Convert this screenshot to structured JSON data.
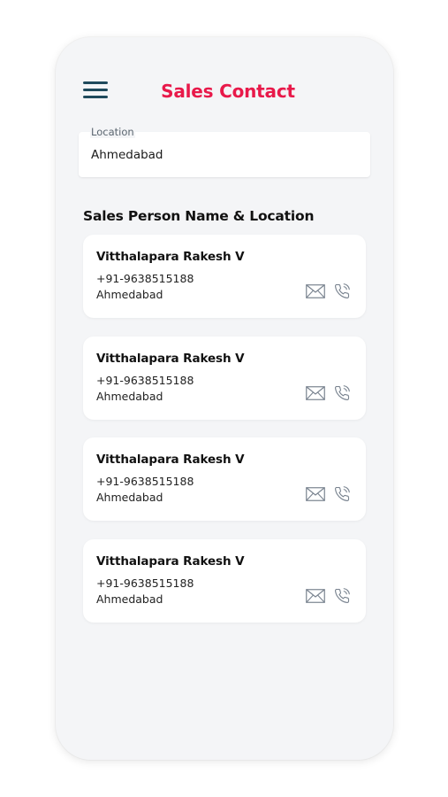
{
  "header": {
    "title": "Sales Contact"
  },
  "location": {
    "label": "Location",
    "value": "Ahmedabad"
  },
  "section": {
    "title": "Sales Person Name & Location"
  },
  "contacts": [
    {
      "name": "Vitthalapara Rakesh V",
      "phone": "+91-9638515188",
      "city": "Ahmedabad"
    },
    {
      "name": "Vitthalapara Rakesh V",
      "phone": "+91-9638515188",
      "city": "Ahmedabad"
    },
    {
      "name": "Vitthalapara Rakesh V",
      "phone": "+91-9638515188",
      "city": "Ahmedabad"
    },
    {
      "name": "Vitthalapara Rakesh V",
      "phone": "+91-9638515188",
      "city": "Ahmedabad"
    }
  ],
  "icons": {
    "menu": "hamburger-menu-icon",
    "mail": "mail-icon",
    "call": "phone-call-icon"
  },
  "colors": {
    "title": "#e8194a",
    "menu": "#1f4a5c",
    "icon": "#7a8490",
    "background": "#f4f5f7",
    "card": "#ffffff"
  }
}
